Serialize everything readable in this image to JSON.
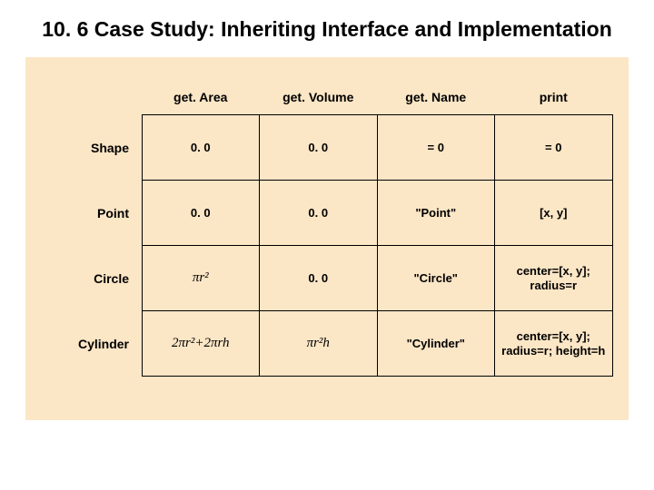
{
  "title": "10. 6  Case Study: Inheriting Interface and Implementation",
  "headers": {
    "c1": "get. Area",
    "c2": "get. Volume",
    "c3": "get. Name",
    "c4": "print"
  },
  "rows": {
    "r1": {
      "label": "Shape",
      "c1": "0. 0",
      "c2": "0. 0",
      "c3": "= 0",
      "c4": "= 0"
    },
    "r2": {
      "label": "Point",
      "c1": "0. 0",
      "c2": "0. 0",
      "c3": "\"Point\"",
      "c4": "[x, y]"
    },
    "r3": {
      "label": "Circle",
      "c1": "πr²",
      "c2": "0. 0",
      "c3": "\"Circle\"",
      "c4": "center=[x, y]; radius=r"
    },
    "r4": {
      "label": "Cylinder",
      "c1": "2πr²+2πrh",
      "c2": "πr²h",
      "c3": "\"Cylinder\"",
      "c4": "center=[x, y]; radius=r; height=h"
    }
  }
}
